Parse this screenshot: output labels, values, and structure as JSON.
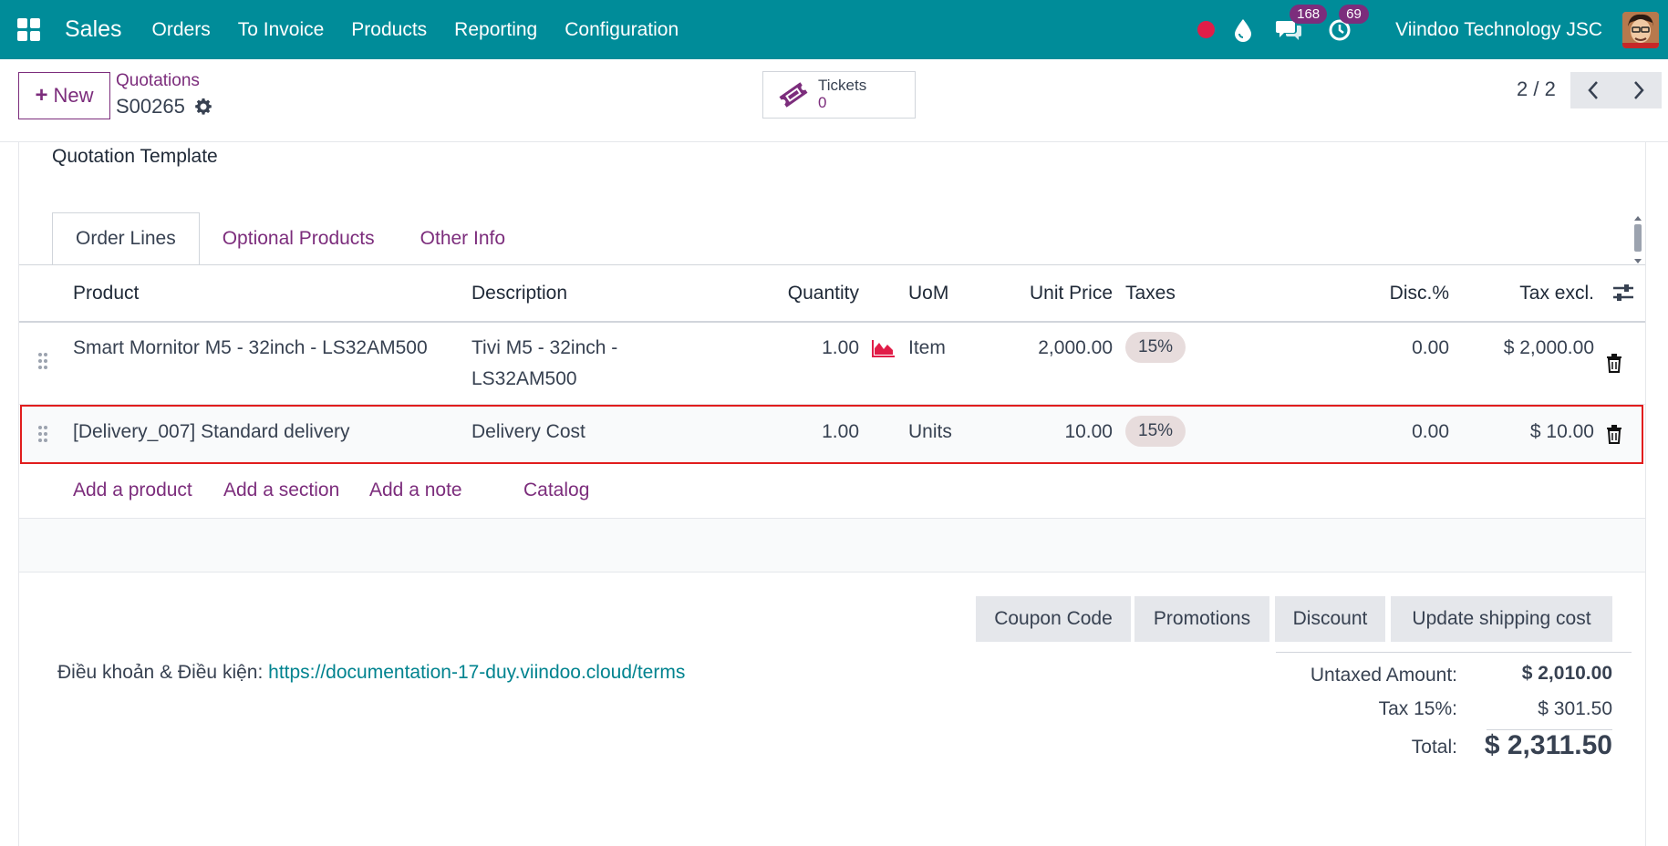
{
  "navbar": {
    "app_name": "Sales",
    "menu": [
      "Orders",
      "To Invoice",
      "Products",
      "Reporting",
      "Configuration"
    ],
    "messages_count": "168",
    "activities_count": "69",
    "company": "Viindoo Technology JSC",
    "accent_color": "#008c99"
  },
  "control": {
    "new_label": "New",
    "breadcrumb_parent": "Quotations",
    "record_name": "S00265",
    "stat_label": "Tickets",
    "stat_value": "0",
    "pager": "2 / 2"
  },
  "form": {
    "quotation_template_label": "Quotation Template",
    "tabs": [
      "Order Lines",
      "Optional Products",
      "Other Info"
    ]
  },
  "order_lines": {
    "columns": [
      "Product",
      "Description",
      "Quantity",
      "UoM",
      "Unit Price",
      "Taxes",
      "Disc.%",
      "Tax excl."
    ],
    "rows": [
      {
        "product": "Smart Mornitor M5 - 32inch - LS32AM500",
        "description_1": "Tivi M5 - 32inch -",
        "description_2": "LS32AM500",
        "quantity": "1.00",
        "uom": "Item",
        "unit_price": "2,000.00",
        "tax": "15%",
        "discount": "0.00",
        "subtotal": "$ 2,000.00"
      },
      {
        "product": "[Delivery_007] Standard delivery",
        "description_1": "Delivery Cost",
        "quantity": "1.00",
        "uom": "Units",
        "unit_price": "10.00",
        "tax": "15%",
        "discount": "0.00",
        "subtotal": "$ 10.00"
      }
    ],
    "add_product": "Add a product",
    "add_section": "Add a section",
    "add_note": "Add a note",
    "catalog": "Catalog"
  },
  "actions": [
    "Coupon Code",
    "Promotions",
    "Discount",
    "Update shipping cost"
  ],
  "terms": {
    "label": "Điều khoản & Điều kiện:",
    "url": "https://documentation-17-duy.viindoo.cloud/terms"
  },
  "totals": {
    "untaxed_label": "Untaxed Amount:",
    "untaxed_value": "$ 2,010.00",
    "tax_label": "Tax 15%:",
    "tax_value": "$ 301.50",
    "total_label": "Total:",
    "total_value": "$ 2,311.50"
  }
}
